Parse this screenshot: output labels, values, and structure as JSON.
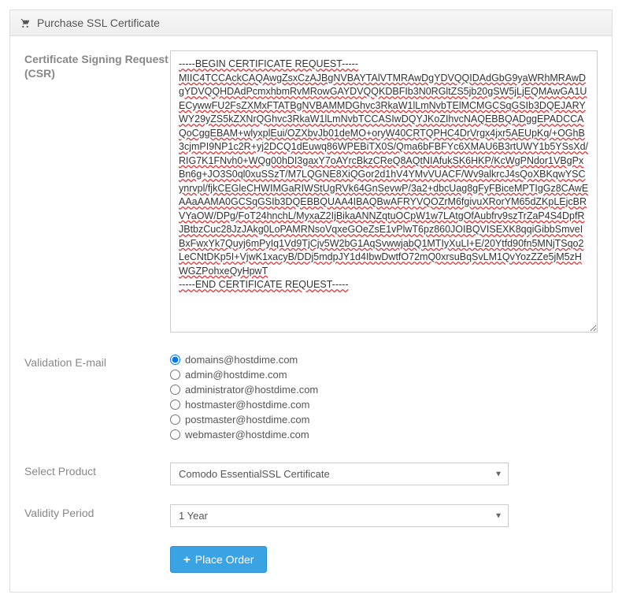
{
  "header": {
    "title": "Purchase SSL Certificate"
  },
  "csr": {
    "label": "Certificate Signing Request (CSR)",
    "value": "-----BEGIN CERTIFICATE REQUEST-----\nMIIC4TCCAckCAQAwgZsxCzAJBgNVBAYTAlVTMRAwDgYDVQQIDAdGbG9yaWRhMRAwDgYDVQQHDAdPcmxhbmRvMRowGAYDVQQKDBFIb3N0RGltZS5jb20gSW5jLjEQMAwGA1UECywwFU2FsZXMxFTATBgNVBAMMDGhvc3RkaW1lLmNvbTElMCMGCSqGSIb3DQEJARYWY29yZS5kZXNrQGhvc3RkaW1lLmNvbTCCASIwDQYJKoZIhvcNAQEBBQADggEPADCCAQoCggEBAM+wlyxplEui/OZXbvJb01deMO+oryW40CRTQPHC4DrVrgx4jxr5AEUpKq/+OGhB3cjmPI9NP1c2R+yj2DCQ1dEuwq86WPEBiTX0S/Qma6bFBFYc6XMAU6B3rtUWY1b5YSsXd/RIG7K1FNvh0+WQg00hDI3gaxY7oAYrcBkzCReQ8AQtNIAfukSK6HKP/KcWgPNdor1VBgPxBn6g+JO3S0ql0xuSSzT/M7LQGNE8XiQGor2d1hV4YMvVUACF/Wv9alkrcJ4sQoXBKqwYSCynrvpl/fjkCEGleCHWIMGaRIWStUgRVk64GnSevwP/3a2+dbcUag8gFyFBiceMPTIgGz8CAwEAAaAAMA0GCSqGSIb3DQEBBQUAA4IBAQBwAFRYVQOZrM6fgivuXRorYM65dZKpLEjcBRVYaOW/DPg/FoT24hnchL/MyxaZ2IjBikaANNZqtuOCpW1w7LAtgOfAubfrv9szTrZaP4S4DpfRJBtbzCuc28JzJAkg0LoPAMRNsoVqxeGOeZsE1vPlwT6pz860JOIBQVISEXK8qqiGibbSmveIBxFwxYk7Quyj6mPyIq1Vd9TjCjv5W2bG1AqSvwwjabQ1MTIyXuLI+E/20Ytfd90fn5MNjTSqo2LeCNtDKp5I+VjwK1xacyB/DDj5mdpJY1d4IbwDwtfO72mQ0xrsuBqSvLM1QvYozZZe5jM5zHWGZPohxeQyHpwT\n-----END CERTIFICATE REQUEST-----"
  },
  "validation": {
    "label": "Validation E-mail",
    "options": [
      "domains@hostdime.com",
      "admin@hostdime.com",
      "administrator@hostdime.com",
      "hostmaster@hostdime.com",
      "postmaster@hostdime.com",
      "webmaster@hostdime.com"
    ],
    "selected": 0
  },
  "product": {
    "label": "Select Product",
    "value": "Comodo EssentialSSL Certificate"
  },
  "validity": {
    "label": "Validity Period",
    "value": "1 Year"
  },
  "action": {
    "place_order": "Place Order"
  }
}
